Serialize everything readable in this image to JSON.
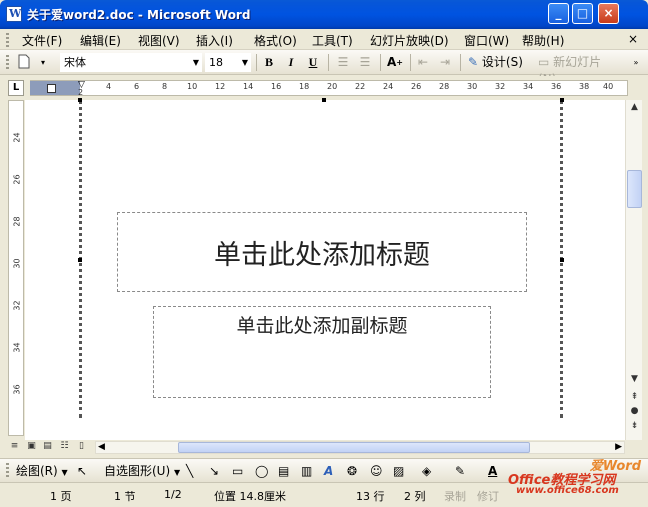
{
  "window": {
    "title": "关于爱word2.doc - Microsoft Word",
    "minimize": "_",
    "maximize": "□",
    "close": "×"
  },
  "menubar": {
    "items": [
      "文件(F)",
      "编辑(E)",
      "视图(V)",
      "插入(I)",
      "格式(O)",
      "工具(T)",
      "幻灯片放映(D)",
      "窗口(W)",
      "帮助(H)"
    ],
    "close_doc": "×"
  },
  "toolbar": {
    "font_name": "宋体",
    "font_size": "18",
    "bold": "B",
    "italic": "I",
    "underline": "U",
    "design_label": "设计(S)",
    "new_slide_label": "新幻灯片(N)"
  },
  "ruler": {
    "corner": "L",
    "ticks": [
      "2",
      "4",
      "6",
      "8",
      "10",
      "12",
      "14",
      "16",
      "18",
      "20",
      "22",
      "24",
      "26",
      "28",
      "30",
      "32",
      "34",
      "36",
      "38",
      "40"
    ]
  },
  "vruler": {
    "ticks": [
      "24",
      "26",
      "28",
      "30",
      "32",
      "34",
      "36"
    ]
  },
  "slide": {
    "title_placeholder": "单击此处添加标题",
    "subtitle_placeholder": "单击此处添加副标题"
  },
  "drawbar": {
    "draw_label": "绘图(R)",
    "autoshapes_label": "自选图形(U)"
  },
  "status": {
    "page": "1 页",
    "section": "1 节",
    "page_of": "1/2",
    "position": "位置 14.8厘米",
    "line": "13 行",
    "column": "2 列",
    "rec": "录制",
    "trk": "修订"
  },
  "watermark": {
    "top": "爱Word",
    "main": "Office教程学习网",
    "url": "www.office68.com"
  },
  "colors": {
    "titlebar": "#0053e1",
    "watermark": "#d8361e"
  }
}
